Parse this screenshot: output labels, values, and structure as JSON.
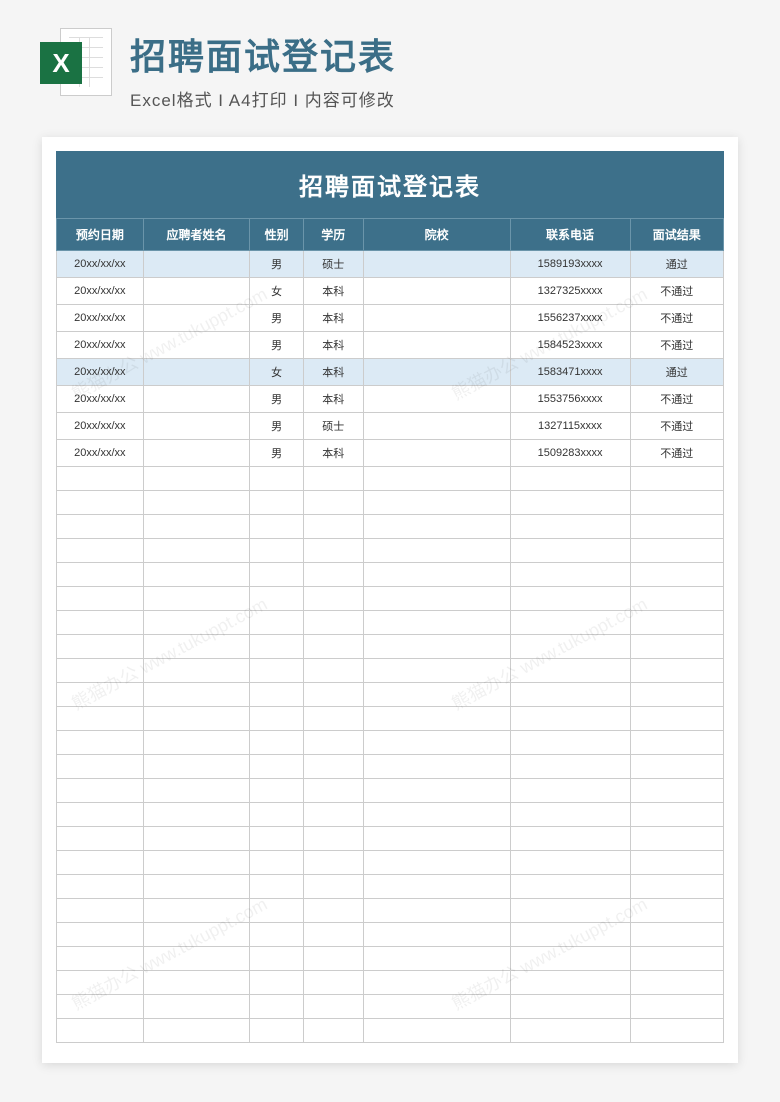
{
  "header": {
    "title": "招聘面试登记表",
    "subtitle": "Excel格式 I A4打印 I 内容可修改",
    "icon_letter": "X"
  },
  "sheet": {
    "title": "招聘面试登记表",
    "columns": [
      "预约日期",
      "应聘者姓名",
      "性别",
      "学历",
      "院校",
      "联系电话",
      "面试结果"
    ],
    "rows": [
      {
        "date": "20xx/xx/xx",
        "name": "",
        "gender": "男",
        "edu": "硕士",
        "school": "",
        "phone": "1589193xxxx",
        "result": "通过",
        "pass": true
      },
      {
        "date": "20xx/xx/xx",
        "name": "",
        "gender": "女",
        "edu": "本科",
        "school": "",
        "phone": "1327325xxxx",
        "result": "不通过",
        "pass": false
      },
      {
        "date": "20xx/xx/xx",
        "name": "",
        "gender": "男",
        "edu": "本科",
        "school": "",
        "phone": "1556237xxxx",
        "result": "不通过",
        "pass": false
      },
      {
        "date": "20xx/xx/xx",
        "name": "",
        "gender": "男",
        "edu": "本科",
        "school": "",
        "phone": "1584523xxxx",
        "result": "不通过",
        "pass": false
      },
      {
        "date": "20xx/xx/xx",
        "name": "",
        "gender": "女",
        "edu": "本科",
        "school": "",
        "phone": "1583471xxxx",
        "result": "通过",
        "pass": true
      },
      {
        "date": "20xx/xx/xx",
        "name": "",
        "gender": "男",
        "edu": "本科",
        "school": "",
        "phone": "1553756xxxx",
        "result": "不通过",
        "pass": false
      },
      {
        "date": "20xx/xx/xx",
        "name": "",
        "gender": "男",
        "edu": "硕士",
        "school": "",
        "phone": "1327115xxxx",
        "result": "不通过",
        "pass": false
      },
      {
        "date": "20xx/xx/xx",
        "name": "",
        "gender": "男",
        "edu": "本科",
        "school": "",
        "phone": "1509283xxxx",
        "result": "不通过",
        "pass": false
      }
    ],
    "empty_row_count": 24
  },
  "watermark": "熊猫办公 www.tukuppt.com"
}
